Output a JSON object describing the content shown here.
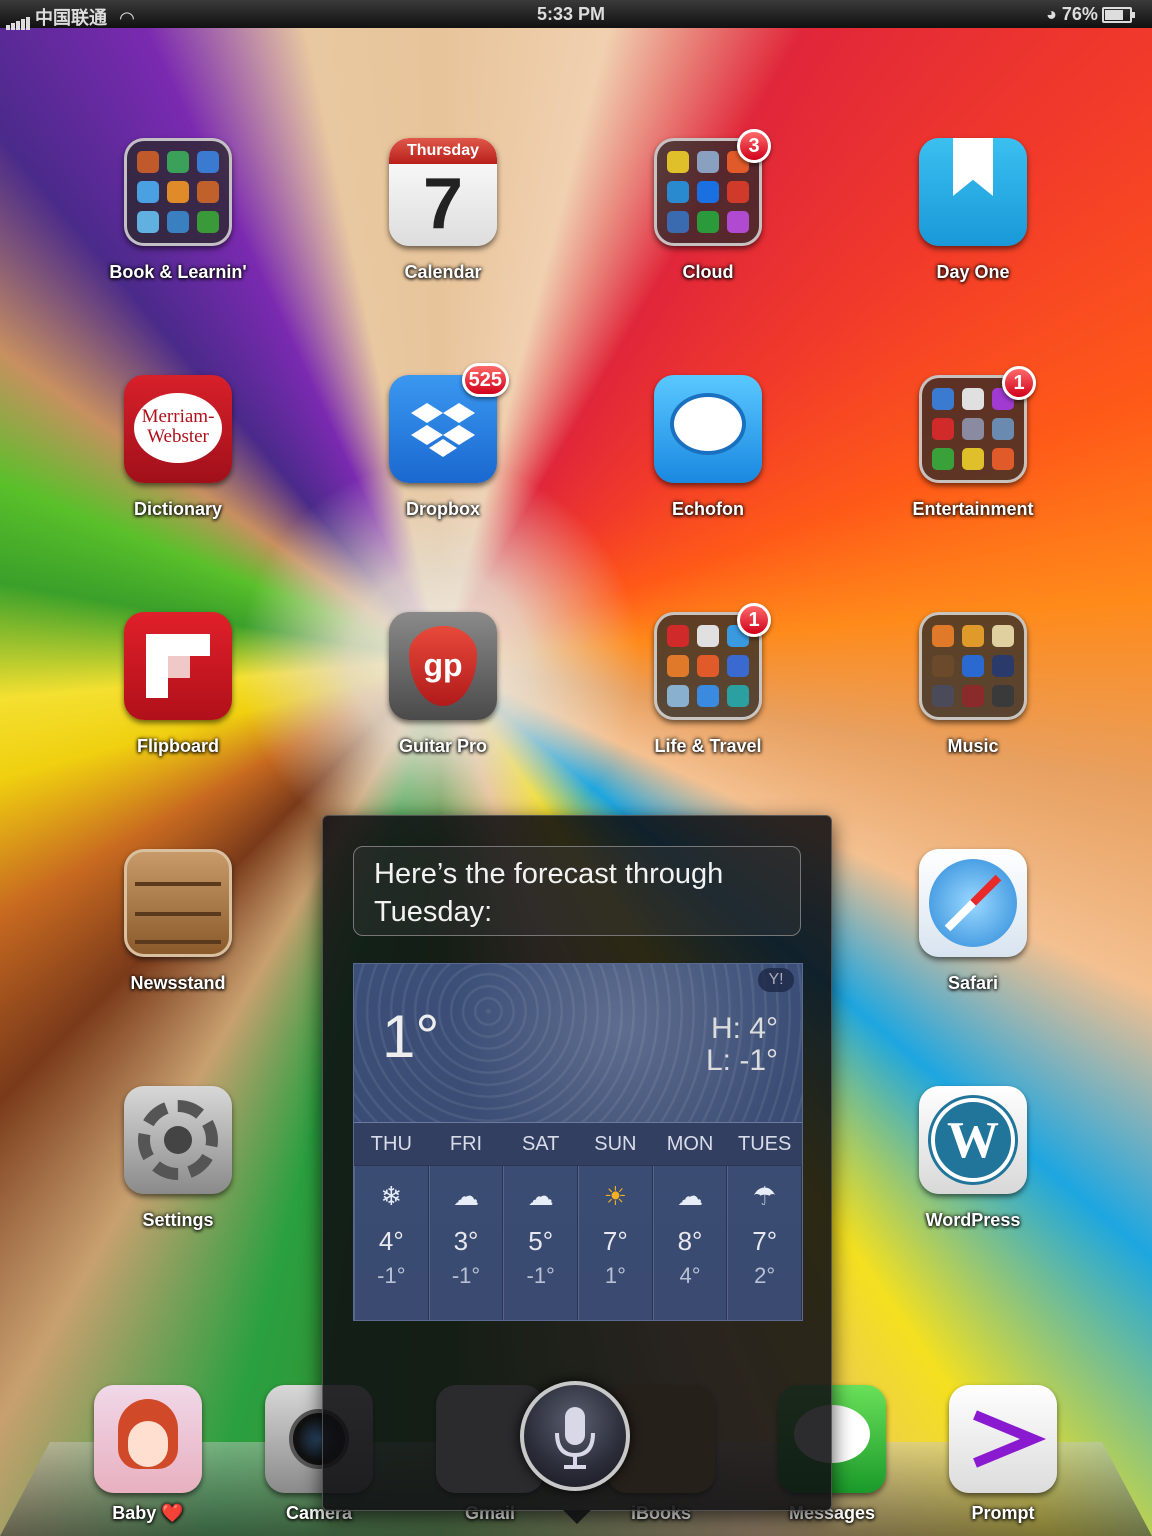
{
  "status_bar": {
    "carrier": "中国联通",
    "time": "5:33 PM",
    "battery": "76%"
  },
  "apps": [
    {
      "label": "Book & Learnin'",
      "icon": "folder-icon",
      "badge": ""
    },
    {
      "label": "Calendar",
      "icon": "calendar-icon",
      "day_name": "Thursday",
      "day_number": "7",
      "badge": ""
    },
    {
      "label": "Cloud",
      "icon": "folder-icon",
      "badge": "3"
    },
    {
      "label": "Day One",
      "icon": "bookmark-icon",
      "badge": ""
    },
    {
      "label": "Dictionary",
      "icon": "merriam-webster-icon",
      "logo_text_1": "Merriam-",
      "logo_text_2": "Webster",
      "badge": ""
    },
    {
      "label": "Dropbox",
      "icon": "dropbox-icon",
      "badge": "525"
    },
    {
      "label": "Echofon",
      "icon": "speech-bubble-icon",
      "badge": ""
    },
    {
      "label": "Entertainment",
      "icon": "folder-icon",
      "badge": "1"
    },
    {
      "label": "Flipboard",
      "icon": "flipboard-icon",
      "badge": ""
    },
    {
      "label": "Guitar Pro",
      "icon": "guitar-pick-icon",
      "logo_text": "gp",
      "badge": ""
    },
    {
      "label": "Life & Travel",
      "icon": "folder-icon",
      "badge": "1"
    },
    {
      "label": "Music",
      "icon": "folder-icon",
      "badge": ""
    },
    {
      "label": "Newsstand",
      "icon": "shelf-icon",
      "badge": ""
    },
    {
      "label": "Safari",
      "icon": "compass-icon",
      "badge": ""
    },
    {
      "label": "Settings",
      "icon": "gear-icon",
      "badge": ""
    },
    {
      "label": "WordPress",
      "icon": "wordpress-icon",
      "badge": ""
    }
  ],
  "dock": [
    {
      "label": "Baby ❤️",
      "icon": "avatar-icon"
    },
    {
      "label": "Camera",
      "icon": "camera-icon"
    },
    {
      "label": "Gmail",
      "icon": "gmail-icon"
    },
    {
      "label": "iBooks",
      "icon": "book-icon"
    },
    {
      "label": "Messages",
      "icon": "message-icon"
    },
    {
      "label": "Prompt",
      "icon": "prompt-icon"
    }
  ],
  "siri": {
    "response": "Here’s the forecast through Tuesday:",
    "weather": {
      "current_temp": "1°",
      "high": "H: 4°",
      "low": "L: -1°",
      "days": [
        {
          "day": "THU",
          "icon": "snow-icon",
          "high": "4°",
          "low": "-1°"
        },
        {
          "day": "FRI",
          "icon": "cloud-icon",
          "high": "3°",
          "low": "-1°"
        },
        {
          "day": "SAT",
          "icon": "cloud-icon",
          "high": "5°",
          "low": "-1°"
        },
        {
          "day": "SUN",
          "icon": "sun-icon",
          "high": "7°",
          "low": "1°"
        },
        {
          "day": "MON",
          "icon": "cloud-icon",
          "high": "8°",
          "low": "4°"
        },
        {
          "day": "TUES",
          "icon": "rain-icon",
          "high": "7°",
          "low": "2°"
        }
      ]
    }
  }
}
